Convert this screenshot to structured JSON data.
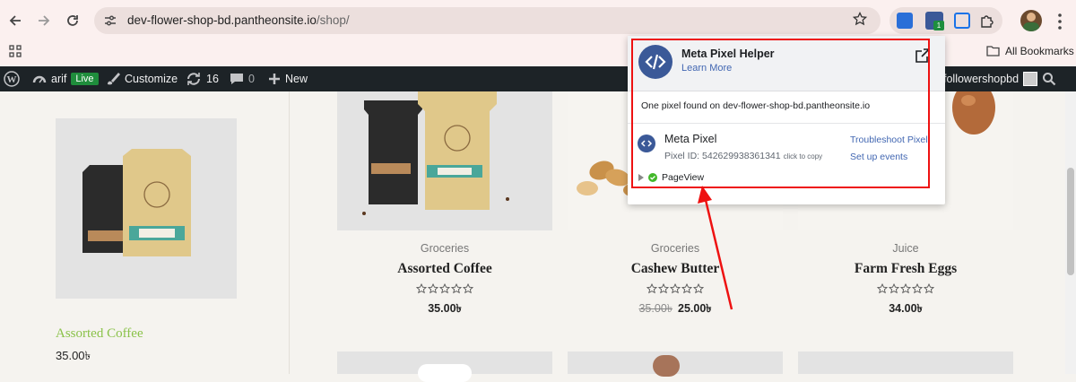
{
  "browser": {
    "url_host": "dev-flower-shop-bd.pantheonsite.io",
    "url_path": "/shop/",
    "bookmarks_label": "All Bookmarks",
    "extension_badge": "1"
  },
  "wp_admin_bar": {
    "site_name": "arif",
    "live_badge": "Live",
    "customize_label": "Customize",
    "updates_count": "16",
    "comments_count": "0",
    "new_label": "New",
    "user_name": "followershopbd"
  },
  "sidebar_product": {
    "title": "Assorted Coffee",
    "price": "35.00৳"
  },
  "products": [
    {
      "category": "Groceries",
      "name": "Assorted Coffee",
      "price": "35.00৳",
      "old_price": "",
      "rating": 0
    },
    {
      "category": "Groceries",
      "name": "Cashew Butter",
      "price": "25.00৳",
      "old_price": "35.00৳",
      "rating": 0
    },
    {
      "category": "Juice",
      "name": "Farm Fresh Eggs",
      "price": "34.00৳",
      "rating": 0
    }
  ],
  "pixel_helper": {
    "title": "Meta Pixel Helper",
    "learn_more": "Learn More",
    "found_text": "One pixel found on dev-flower-shop-bd.pantheonsite.io",
    "pixel_name": "Meta Pixel",
    "pixel_id_label": "Pixel ID: 542629938361341",
    "click_to_copy": "click to copy",
    "troubleshoot": "Troubleshoot Pixel",
    "setup_events": "Set up events",
    "event_name": "PageView"
  },
  "colors": {
    "annotation": "#e11111",
    "wp_bar": "#1d2327",
    "accent_green": "#8ac249",
    "fb_blue": "#3b5998"
  }
}
